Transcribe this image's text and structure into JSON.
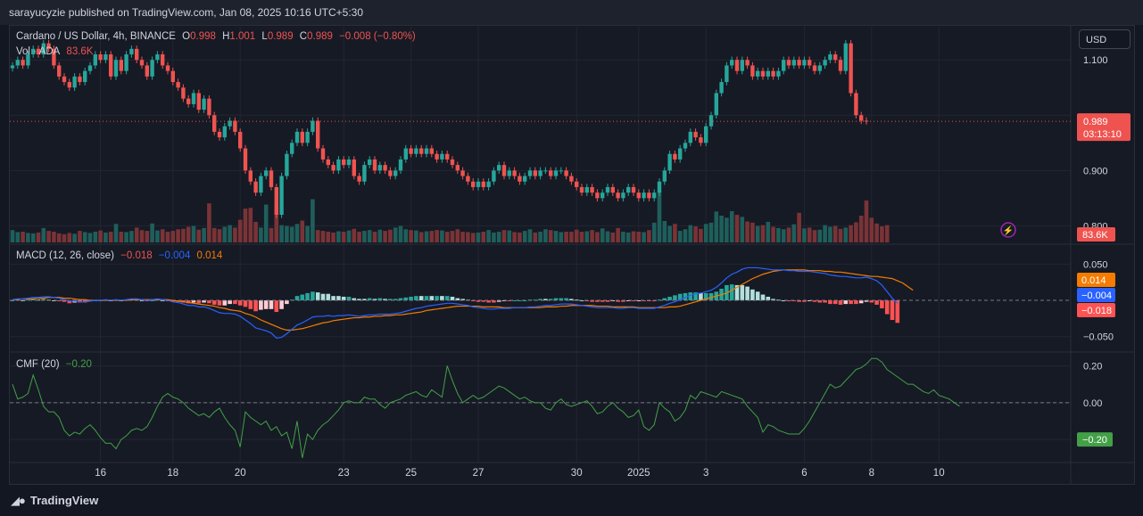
{
  "publisher": "sarayucyzie published on TradingView.com, Jan 08, 2025 10:16 UTC+5:30",
  "brand": "TradingView",
  "currency_button": "USD",
  "main_legend": {
    "title": "Cardano / US Dollar, 4h, BINANCE",
    "o_label": "O",
    "o_value": "0.998",
    "h_label": "H",
    "h_value": "1.001",
    "l_label": "L",
    "l_value": "0.989",
    "c_label": "C",
    "c_value": "0.989",
    "change": "−0.008 (−0.80%)",
    "vol_label": "Vol · ADA",
    "vol_value": "83.6K"
  },
  "macd_legend": {
    "label": "MACD (12, 26, close)",
    "hist": "−0.018",
    "macd": "−0.004",
    "signal": "0.014"
  },
  "cmf_legend": {
    "label": "CMF (20)",
    "value": "−0.20"
  },
  "colors": {
    "up": "#26a69a",
    "down": "#ef5350",
    "vol_up": "#1f5f5b",
    "vol_down": "#7a3336",
    "macd": "#2962ff",
    "signal": "#f57c00",
    "cmf": "#43a047",
    "grid": "#232632",
    "axis_text": "#d1d4dc"
  },
  "chart_data": [
    {
      "type": "candlestick",
      "title": "Cardano / US Dollar, 4h, BINANCE",
      "y_ticks": [
        "1.100",
        "0.900",
        "0.800"
      ],
      "y_tick_values": [
        1.1,
        0.9,
        0.8
      ],
      "ylim": [
        0.77,
        1.16
      ],
      "last_price_label": "0.989",
      "countdown_label": "03:13:10",
      "price_line": 0.989,
      "x_tick_labels": [
        "16",
        "18",
        "20",
        "23",
        "25",
        "27",
        "30",
        "2025",
        "3",
        "6",
        "8",
        "10"
      ],
      "x_tick_index": [
        17,
        31,
        44,
        64,
        77,
        90,
        109,
        121,
        134,
        153,
        166,
        179
      ],
      "closes": [
        1.09,
        1.1,
        1.09,
        1.11,
        1.12,
        1.11,
        1.13,
        1.12,
        1.09,
        1.07,
        1.06,
        1.05,
        1.07,
        1.06,
        1.08,
        1.09,
        1.11,
        1.1,
        1.11,
        1.07,
        1.1,
        1.08,
        1.11,
        1.12,
        1.1,
        1.09,
        1.07,
        1.1,
        1.11,
        1.09,
        1.08,
        1.06,
        1.05,
        1.03,
        1.02,
        1.04,
        1.01,
        1.03,
        1.0,
        0.97,
        0.96,
        0.98,
        0.99,
        0.97,
        0.94,
        0.9,
        0.88,
        0.86,
        0.89,
        0.9,
        0.87,
        0.82,
        0.89,
        0.93,
        0.95,
        0.97,
        0.95,
        0.97,
        0.99,
        0.94,
        0.92,
        0.91,
        0.9,
        0.92,
        0.91,
        0.92,
        0.89,
        0.88,
        0.91,
        0.92,
        0.9,
        0.91,
        0.9,
        0.89,
        0.9,
        0.92,
        0.94,
        0.93,
        0.94,
        0.93,
        0.94,
        0.93,
        0.92,
        0.93,
        0.92,
        0.91,
        0.9,
        0.89,
        0.88,
        0.87,
        0.88,
        0.87,
        0.88,
        0.9,
        0.91,
        0.89,
        0.9,
        0.89,
        0.88,
        0.89,
        0.9,
        0.89,
        0.9,
        0.9,
        0.89,
        0.9,
        0.9,
        0.89,
        0.88,
        0.87,
        0.86,
        0.87,
        0.86,
        0.85,
        0.86,
        0.87,
        0.86,
        0.85,
        0.86,
        0.87,
        0.86,
        0.85,
        0.86,
        0.85,
        0.86,
        0.88,
        0.9,
        0.93,
        0.92,
        0.94,
        0.95,
        0.97,
        0.96,
        0.95,
        0.98,
        1.0,
        1.04,
        1.06,
        1.09,
        1.1,
        1.08,
        1.1,
        1.09,
        1.07,
        1.08,
        1.07,
        1.08,
        1.07,
        1.08,
        1.1,
        1.09,
        1.1,
        1.09,
        1.1,
        1.09,
        1.08,
        1.09,
        1.1,
        1.11,
        1.1,
        1.08,
        1.13,
        1.04,
        1.0,
        0.99,
        0.989
      ],
      "volume": [
        3,
        2.5,
        2.6,
        2.3,
        2.2,
        2.4,
        3.5,
        2.8,
        2.6,
        2.2,
        2.0,
        2.3,
        2.1,
        2.8,
        2.5,
        2.3,
        2.6,
        2.9,
        2.4,
        2.6,
        4.5,
        2.6,
        2.5,
        2.8,
        3.6,
        3.0,
        2.8,
        4.6,
        2.9,
        3.2,
        2.6,
        2.8,
        3.2,
        3.3,
        3.8,
        4.0,
        3.1,
        3.5,
        9.5,
        3.5,
        3.2,
        3.8,
        4.2,
        3.6,
        5.5,
        8.2,
        8.4,
        5.0,
        3.6,
        9.2,
        3.5,
        9.0,
        4.2,
        4.0,
        3.8,
        4.5,
        5.3,
        4.0,
        10.5,
        3.0,
        2.8,
        2.6,
        2.4,
        2.7,
        2.6,
        2.9,
        3.3,
        2.6,
        2.8,
        3.0,
        2.6,
        3.1,
        2.8,
        3.1,
        3.6,
        4.0,
        3.2,
        3.0,
        2.9,
        2.5,
        2.7,
        2.8,
        3.0,
        2.9,
        2.6,
        2.8,
        3.2,
        2.6,
        2.5,
        2.3,
        2.4,
        2.6,
        3.0,
        2.4,
        2.6,
        3.0,
        2.9,
        2.5,
        2.4,
        2.8,
        3.2,
        2.4,
        2.6,
        3.2,
        3.0,
        2.8,
        2.5,
        2.6,
        2.6,
        3.1,
        2.6,
        2.7,
        3.0,
        2.5,
        3.4,
        2.7,
        2.4,
        3.5,
        2.6,
        2.4,
        2.7,
        2.6,
        2.5,
        3.0,
        4.8,
        12.5,
        5.2,
        4.0,
        4.5,
        2.8,
        3.2,
        4.2,
        3.9,
        3.3,
        4.5,
        4.8,
        7.5,
        6.5,
        6.0,
        7.6,
        6.7,
        6.2,
        5.1,
        4.8,
        4.0,
        4.2,
        5.0,
        3.8,
        3.5,
        3.2,
        3.6,
        4.4,
        7.2,
        3.4,
        3.6,
        3.0,
        3.1,
        4.2,
        3.8,
        4.0,
        3.3,
        3.6,
        4.2,
        4.9,
        6.5,
        10.2,
        6.0,
        4.6,
        3.9,
        4.2
      ]
    },
    {
      "type": "line",
      "title": "MACD (12, 26, close)",
      "y_ticks": [
        "0.050",
        "−0.050"
      ],
      "y_tick_values": [
        0.05,
        -0.05
      ],
      "ylim": [
        -0.07,
        0.075
      ],
      "zero_line": 0,
      "labels": {
        "signal": "0.014",
        "macd": "−0.004",
        "hist": "−0.018"
      },
      "series": [
        {
          "values": [
            0.001,
            0.002,
            0.002,
            0.003,
            0.004,
            0.004,
            0.005,
            0.005,
            0.004,
            0.003,
            0.001,
            -0.001,
            -0.001,
            -0.002,
            -0.002,
            -0.001,
            0.0,
            0.0,
            0.001,
            0.0,
            0.001,
            0.0,
            0.001,
            0.002,
            0.002,
            0.001,
            0.0,
            0.001,
            0.002,
            0.001,
            0.0,
            -0.002,
            -0.003,
            -0.005,
            -0.007,
            -0.007,
            -0.009,
            -0.009,
            -0.011,
            -0.014,
            -0.017,
            -0.018,
            -0.018,
            -0.019,
            -0.022,
            -0.027,
            -0.032,
            -0.038,
            -0.04,
            -0.042,
            -0.045,
            -0.052,
            -0.051,
            -0.046,
            -0.04,
            -0.034,
            -0.031,
            -0.027,
            -0.023,
            -0.022,
            -0.022,
            -0.021,
            -0.022,
            -0.021,
            -0.021,
            -0.02,
            -0.021,
            -0.022,
            -0.021,
            -0.02,
            -0.02,
            -0.019,
            -0.019,
            -0.019,
            -0.018,
            -0.017,
            -0.015,
            -0.013,
            -0.011,
            -0.01,
            -0.008,
            -0.007,
            -0.006,
            -0.005,
            -0.004,
            -0.004,
            -0.005,
            -0.006,
            -0.007,
            -0.009,
            -0.01,
            -0.011,
            -0.012,
            -0.012,
            -0.011,
            -0.011,
            -0.011,
            -0.01,
            -0.01,
            -0.01,
            -0.009,
            -0.009,
            -0.008,
            -0.007,
            -0.007,
            -0.006,
            -0.005,
            -0.005,
            -0.005,
            -0.006,
            -0.007,
            -0.008,
            -0.009,
            -0.01,
            -0.01,
            -0.01,
            -0.01,
            -0.011,
            -0.011,
            -0.01,
            -0.01,
            -0.011,
            -0.011,
            -0.011,
            -0.011,
            -0.009,
            -0.007,
            -0.004,
            -0.002,
            0.001,
            0.004,
            0.007,
            0.009,
            0.01,
            0.012,
            0.014,
            0.018,
            0.024,
            0.031,
            0.036,
            0.039,
            0.043,
            0.045,
            0.045,
            0.045,
            0.044,
            0.043,
            0.042,
            0.042,
            0.042,
            0.041,
            0.041,
            0.04,
            0.04,
            0.04,
            0.039,
            0.038,
            0.037,
            0.035,
            0.034,
            0.033,
            0.033,
            0.032,
            0.031,
            0.031,
            0.032,
            0.03,
            0.027,
            0.021,
            0.012,
            0.003,
            -0.004
          ],
          "color": "#2962ff"
        },
        {
          "values": [
            0.001,
            0.001,
            0.002,
            0.002,
            0.002,
            0.003,
            0.003,
            0.004,
            0.004,
            0.004,
            0.003,
            0.003,
            0.002,
            0.001,
            0.001,
            0.0,
            0.0,
            0.0,
            0.0,
            0.0,
            0.0,
            0.0,
            0.0,
            0.001,
            0.001,
            0.001,
            0.001,
            0.001,
            0.001,
            0.001,
            0.001,
            0.0,
            -0.001,
            -0.002,
            -0.003,
            -0.004,
            -0.005,
            -0.006,
            -0.007,
            -0.008,
            -0.01,
            -0.011,
            -0.013,
            -0.014,
            -0.015,
            -0.018,
            -0.02,
            -0.023,
            -0.027,
            -0.03,
            -0.033,
            -0.036,
            -0.039,
            -0.041,
            -0.041,
            -0.04,
            -0.039,
            -0.037,
            -0.035,
            -0.033,
            -0.031,
            -0.03,
            -0.028,
            -0.027,
            -0.026,
            -0.025,
            -0.024,
            -0.024,
            -0.023,
            -0.023,
            -0.022,
            -0.022,
            -0.021,
            -0.021,
            -0.02,
            -0.02,
            -0.019,
            -0.018,
            -0.017,
            -0.016,
            -0.014,
            -0.013,
            -0.012,
            -0.011,
            -0.01,
            -0.009,
            -0.008,
            -0.008,
            -0.008,
            -0.008,
            -0.008,
            -0.009,
            -0.009,
            -0.009,
            -0.009,
            -0.01,
            -0.01,
            -0.01,
            -0.01,
            -0.01,
            -0.01,
            -0.01,
            -0.01,
            -0.009,
            -0.009,
            -0.009,
            -0.008,
            -0.008,
            -0.007,
            -0.007,
            -0.007,
            -0.007,
            -0.007,
            -0.008,
            -0.008,
            -0.008,
            -0.009,
            -0.009,
            -0.009,
            -0.009,
            -0.009,
            -0.01,
            -0.01,
            -0.01,
            -0.01,
            -0.01,
            -0.01,
            -0.009,
            -0.009,
            -0.008,
            -0.006,
            -0.004,
            -0.002,
            0.0,
            0.002,
            0.004,
            0.006,
            0.008,
            0.01,
            0.014,
            0.018,
            0.022,
            0.026,
            0.03,
            0.033,
            0.036,
            0.038,
            0.04,
            0.041,
            0.042,
            0.042,
            0.042,
            0.042,
            0.042,
            0.041,
            0.041,
            0.041,
            0.04,
            0.04,
            0.039,
            0.039,
            0.038,
            0.037,
            0.036,
            0.035,
            0.034,
            0.033,
            0.033,
            0.032,
            0.031,
            0.03,
            0.027,
            0.024,
            0.019,
            0.014
          ],
          "color": "#f57c00"
        }
      ]
    },
    {
      "type": "line",
      "title": "CMF (20)",
      "y_ticks": [
        "0.20",
        "0.00"
      ],
      "y_tick_values": [
        0.2,
        0
      ],
      "ylim": [
        -0.32,
        0.27
      ],
      "zero_line": 0,
      "last_label": "−0.20",
      "series": [
        {
          "values": [
            0.1,
            0.02,
            0.03,
            0.05,
            0.15,
            0.07,
            -0.02,
            -0.05,
            -0.05,
            -0.08,
            -0.15,
            -0.18,
            -0.16,
            -0.17,
            -0.14,
            -0.12,
            -0.15,
            -0.19,
            -0.22,
            -0.22,
            -0.25,
            -0.2,
            -0.18,
            -0.15,
            -0.14,
            -0.15,
            -0.13,
            -0.08,
            -0.02,
            0.03,
            0.05,
            0.03,
            0.02,
            0.0,
            -0.03,
            -0.05,
            -0.07,
            -0.06,
            -0.08,
            -0.05,
            -0.03,
            -0.08,
            -0.12,
            -0.15,
            -0.24,
            -0.05,
            -0.08,
            -0.1,
            -0.12,
            -0.1,
            -0.15,
            -0.13,
            -0.18,
            -0.16,
            -0.25,
            -0.1,
            -0.3,
            -0.17,
            -0.2,
            -0.15,
            -0.12,
            -0.1,
            -0.07,
            -0.04,
            0.0,
            0.01,
            0.0,
            0.0,
            0.03,
            0.02,
            0.02,
            -0.01,
            -0.03,
            0.0,
            0.01,
            0.02,
            0.04,
            0.05,
            0.06,
            0.04,
            0.03,
            0.07,
            0.05,
            0.03,
            0.2,
            0.12,
            0.05,
            0.0,
            0.02,
            0.04,
            0.02,
            0.03,
            0.05,
            0.07,
            0.09,
            0.08,
            0.06,
            0.04,
            0.02,
            0.03,
            0.01,
            0.0,
            0.0,
            -0.03,
            -0.04,
            0.0,
            0.02,
            -0.01,
            -0.02,
            -0.01,
            0.0,
            0.01,
            -0.02,
            -0.06,
            -0.05,
            -0.02,
            0.0,
            -0.03,
            -0.05,
            -0.08,
            -0.07,
            -0.04,
            -0.13,
            -0.15,
            -0.12,
            0.0,
            -0.03,
            -0.05,
            -0.1,
            -0.08,
            -0.04,
            0.04,
            0.02,
            0.06,
            0.05,
            0.04,
            0.03,
            0.06,
            0.05,
            0.04,
            0.03,
            0.02,
            -0.02,
            -0.05,
            -0.08,
            -0.16,
            -0.12,
            -0.13,
            -0.15,
            -0.16,
            -0.17,
            -0.17,
            -0.17,
            -0.14,
            -0.1,
            -0.05,
            0.0,
            0.05,
            0.1,
            0.08,
            0.09,
            0.12,
            0.15,
            0.18,
            0.19,
            0.21,
            0.24,
            0.24,
            0.22,
            0.18,
            0.16,
            0.14,
            0.12,
            0.1,
            0.1,
            0.08,
            0.06,
            0.05,
            0.07,
            0.04,
            0.03,
            0.02,
            0.0,
            -0.02
          ],
          "color": "#43a047"
        }
      ]
    }
  ]
}
